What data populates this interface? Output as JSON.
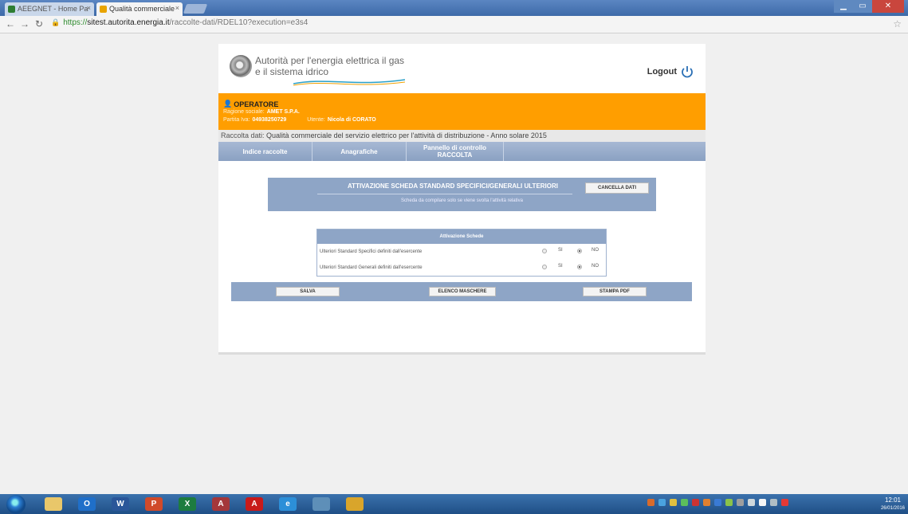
{
  "browser": {
    "tabs": [
      {
        "label": "AEEGNET - Home Pa",
        "favicon_color": "#2e7d32"
      },
      {
        "label": "Qualità commerciale",
        "favicon_color": "#e8a400"
      }
    ],
    "url": {
      "scheme": "https://",
      "host": "sitest.autorita.energia.it",
      "path": "/raccolte-dati/RDEL10?execution=e3s4"
    }
  },
  "header": {
    "brand_line1": "Autorità per l'energia elettrica il gas",
    "brand_line2": "e il sistema idrico",
    "logout_label": "Logout"
  },
  "operator": {
    "title": "OPERATORE",
    "ragione_label": "Ragione sociale:",
    "ragione_value": "AMET S.P.A.",
    "piva_label": "Partita Iva:",
    "piva_value": "04938250729",
    "utente_label": "Utente:",
    "utente_value": "Nicola di CORATO"
  },
  "raccolta": {
    "label": "Raccolta dati:",
    "value": "Qualità commerciale del servizio elettrico per l'attività di distribuzione - Anno solare 2015"
  },
  "menu": {
    "items": [
      "Indice raccolte",
      "Anagrafiche",
      "Pannello di controllo",
      "RACCOLTA"
    ]
  },
  "attivazione": {
    "title": "ATTIVAZIONE SCHEDA STANDARD SPECIFICI/GENERALI ULTERIORI",
    "cancel_label": "CANCELLA DATI",
    "note": "Scheda da compilare solo se viene svolta l'attività relativa"
  },
  "schede": {
    "header": "Attivazione Schede",
    "rows": [
      {
        "label": "Ulteriori Standard Specifici definiti dall'esercente",
        "selected": "NO"
      },
      {
        "label": "Ulteriori Standard Generali definiti dall'esercente",
        "selected": "NO"
      }
    ],
    "option_si": "SI",
    "option_no": "NO"
  },
  "actions": {
    "save_label": "SALVA",
    "list_label": "ELENCO MASCHERE",
    "print_label": "STAMPA PDF"
  },
  "taskbar": {
    "apps": [
      {
        "icon": "folder-icon",
        "letter": "",
        "color": "#e9c76a"
      },
      {
        "icon": "outlook-icon",
        "letter": "O",
        "color": "#1f6fc9"
      },
      {
        "icon": "word-icon",
        "letter": "W",
        "color": "#2a5699"
      },
      {
        "icon": "powerpoint-icon",
        "letter": "P",
        "color": "#d04a2a"
      },
      {
        "icon": "excel-icon",
        "letter": "X",
        "color": "#1d7c3f"
      },
      {
        "icon": "access-icon",
        "letter": "A",
        "color": "#a4373a"
      },
      {
        "icon": "acrobat-icon",
        "letter": "A",
        "color": "#c81a1a"
      },
      {
        "icon": "ie-icon",
        "letter": "e",
        "color": "#2c8fd8"
      },
      {
        "icon": "media-icon",
        "letter": "",
        "color": "#5e8fb8"
      },
      {
        "icon": "chrome-icon",
        "letter": "",
        "color": "#d9a52b"
      }
    ],
    "time": "12:01",
    "date": "26/01/2016"
  }
}
